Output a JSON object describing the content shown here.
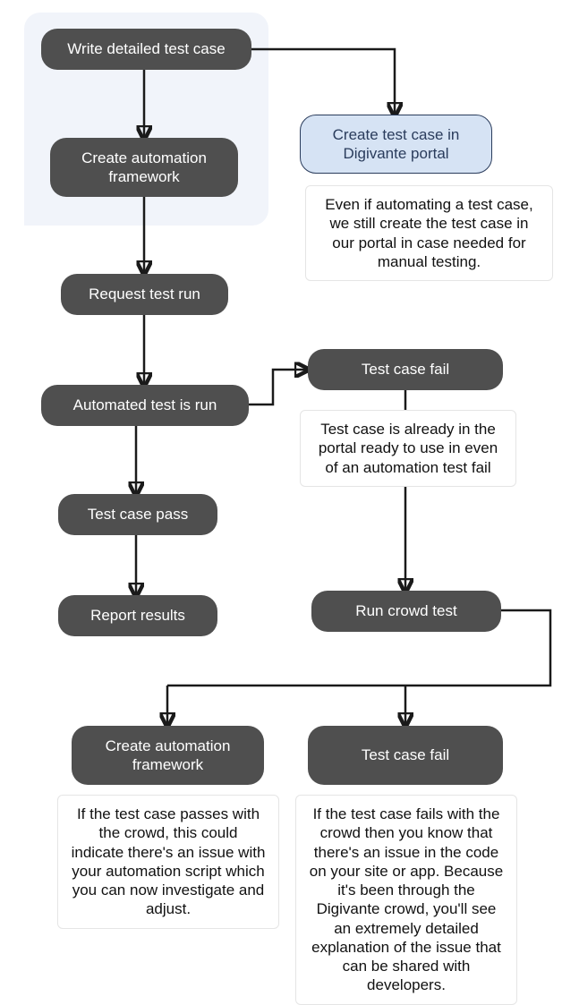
{
  "nodes": {
    "write_test_case": "Write detailed test case",
    "create_framework_top": "Create automation framework",
    "create_portal": "Create test case in Digivante portal",
    "request_run": "Request test run",
    "automated_run": "Automated test is run",
    "fail_top": "Test case fail",
    "pass": "Test case pass",
    "report": "Report results",
    "crowd_test": "Run crowd test",
    "create_framework_bottom": "Create automation framework",
    "fail_bottom": "Test case fail"
  },
  "notes": {
    "portal_note": "Even if automating a test case, we still create the test case in our portal in case needed for manual testing.",
    "fail_note": "Test case is already in the portal ready to use in even of an automation test fail",
    "pass_crowd_note": "If the test case passes with the crowd, this could indicate there's an issue with your automation script which you can now investigate and adjust.",
    "fail_crowd_note": "If the test case fails with the crowd then you know that there's an issue in the code on your site or app. Because it's been through the Digivante crowd, you'll see an extremely detailed explanation of the issue that can be shared with developers."
  }
}
